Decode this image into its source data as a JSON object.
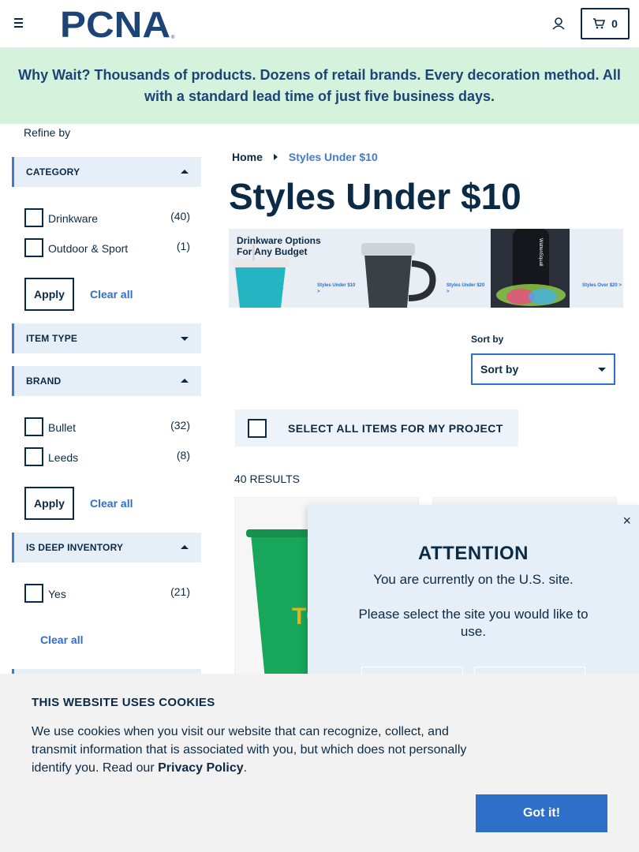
{
  "header": {
    "logo_text": "PCNA",
    "cart_count": "0"
  },
  "promo": {
    "text": "Why Wait? Thousands of products. Dozens of retail brands. Every decoration method. All with a standard lead time of just five business days."
  },
  "sidebar": {
    "refine_label": "Refine by",
    "facets": {
      "category": {
        "title": "CATEGORY",
        "options": [
          {
            "label": "Drinkware",
            "count": "(40)"
          },
          {
            "label": "Outdoor & Sport",
            "count": "(1)"
          }
        ],
        "apply_label": "Apply",
        "clear_label": "Clear all"
      },
      "item_type": {
        "title": "ITEM TYPE"
      },
      "brand": {
        "title": "BRAND",
        "options": [
          {
            "label": "Bullet",
            "count": "(32)"
          },
          {
            "label": "Leeds",
            "count": "(8)"
          }
        ],
        "apply_label": "Apply",
        "clear_label": "Clear all"
      },
      "deep_inventory": {
        "title": "IS DEEP INVENTORY",
        "options": [
          {
            "label": "Yes",
            "count": "(21)"
          }
        ],
        "clear_label": "Clear all"
      }
    }
  },
  "breadcrumb": {
    "home": "Home",
    "current": "Styles Under $10"
  },
  "page_title": "Styles Under $10",
  "hero": {
    "heading": "Drinkware Options For Any Budget",
    "links": [
      "Styles Under $10 >",
      "Styles Under $20 >",
      "Styles Over $20 >"
    ],
    "brand_text": "WattenSquall"
  },
  "sort": {
    "label": "Sort by",
    "selected": "Sort by"
  },
  "select_all_label": "SELECT ALL ITEMS FOR MY PROJECT",
  "results_label": "40 RESULTS",
  "product_card_1": {
    "cup_text": "TO"
  },
  "modal": {
    "title": "ATTENTION",
    "line1": "You are currently on the U.S. site.",
    "line2": "Please select the site you would like to use.",
    "close": "×"
  },
  "cookie": {
    "title": "THIS WEBSITE USES COOKIES",
    "text_before": "We use cookies when you visit our website that can recognize, collect, and transmit information that is associated with you, but which does not personally identify you. Read our ",
    "link": "Privacy Policy",
    "text_after": ".",
    "button": "Got it!"
  },
  "colors": {
    "navy": "#0b2a45",
    "accent_blue": "#2e6fc9",
    "promo_bg": "#d4f2dc",
    "facet_bg": "#e6eef7"
  }
}
